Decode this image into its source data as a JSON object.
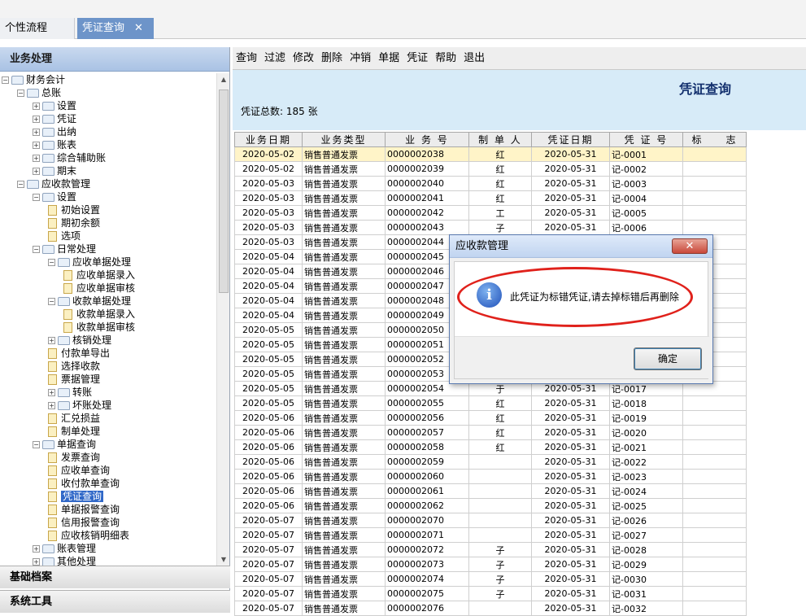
{
  "tabs": [
    {
      "label": "个性流程"
    },
    {
      "label": "凭证查询",
      "close": "✕"
    }
  ],
  "left": {
    "header": "业务处理",
    "footer": [
      "基础档案",
      "系统工具"
    ],
    "tree": [
      {
        "label": "财务会计",
        "indent": 0,
        "kind": "folder",
        "exp": "-"
      },
      {
        "label": "总账",
        "indent": 1,
        "kind": "folder",
        "exp": "-"
      },
      {
        "label": "设置",
        "indent": 2,
        "kind": "folder",
        "exp": "+"
      },
      {
        "label": "凭证",
        "indent": 2,
        "kind": "folder",
        "exp": "+"
      },
      {
        "label": "出纳",
        "indent": 2,
        "kind": "folder",
        "exp": "+"
      },
      {
        "label": "账表",
        "indent": 2,
        "kind": "folder",
        "exp": "+"
      },
      {
        "label": "综合辅助账",
        "indent": 2,
        "kind": "folder",
        "exp": "+"
      },
      {
        "label": "期末",
        "indent": 2,
        "kind": "folder",
        "exp": "+"
      },
      {
        "label": "应收款管理",
        "indent": 1,
        "kind": "folder",
        "exp": "-"
      },
      {
        "label": "设置",
        "indent": 2,
        "kind": "folder",
        "exp": "-"
      },
      {
        "label": "初始设置",
        "indent": 3,
        "kind": "doc"
      },
      {
        "label": "期初余额",
        "indent": 3,
        "kind": "doc"
      },
      {
        "label": "选项",
        "indent": 3,
        "kind": "doc"
      },
      {
        "label": "日常处理",
        "indent": 2,
        "kind": "folder",
        "exp": "-"
      },
      {
        "label": "应收单据处理",
        "indent": 3,
        "kind": "folder",
        "exp": "-"
      },
      {
        "label": "应收单据录入",
        "indent": 4,
        "kind": "doc"
      },
      {
        "label": "应收单据审核",
        "indent": 4,
        "kind": "doc"
      },
      {
        "label": "收款单据处理",
        "indent": 3,
        "kind": "folder",
        "exp": "-"
      },
      {
        "label": "收款单据录入",
        "indent": 4,
        "kind": "doc"
      },
      {
        "label": "收款单据审核",
        "indent": 4,
        "kind": "doc"
      },
      {
        "label": "核销处理",
        "indent": 3,
        "kind": "folder",
        "exp": "+"
      },
      {
        "label": "付款单导出",
        "indent": 3,
        "kind": "doc"
      },
      {
        "label": "选择收款",
        "indent": 3,
        "kind": "doc"
      },
      {
        "label": "票据管理",
        "indent": 3,
        "kind": "doc"
      },
      {
        "label": "转账",
        "indent": 3,
        "kind": "folder",
        "exp": "+"
      },
      {
        "label": "坏账处理",
        "indent": 3,
        "kind": "folder",
        "exp": "+"
      },
      {
        "label": "汇兑损益",
        "indent": 3,
        "kind": "doc"
      },
      {
        "label": "制单处理",
        "indent": 3,
        "kind": "doc"
      },
      {
        "label": "单据查询",
        "indent": 2,
        "kind": "folder",
        "exp": "-"
      },
      {
        "label": "发票查询",
        "indent": 3,
        "kind": "doc"
      },
      {
        "label": "应收单查询",
        "indent": 3,
        "kind": "doc"
      },
      {
        "label": "收付款单查询",
        "indent": 3,
        "kind": "doc"
      },
      {
        "label": "凭证查询",
        "indent": 3,
        "kind": "doc",
        "selected": true
      },
      {
        "label": "单据报警查询",
        "indent": 3,
        "kind": "doc"
      },
      {
        "label": "信用报警查询",
        "indent": 3,
        "kind": "doc"
      },
      {
        "label": "应收核销明细表",
        "indent": 3,
        "kind": "doc"
      },
      {
        "label": "账表管理",
        "indent": 2,
        "kind": "folder",
        "exp": "+"
      },
      {
        "label": "其他处理",
        "indent": 2,
        "kind": "folder",
        "exp": "+"
      }
    ]
  },
  "toolbar": [
    "查询",
    "过滤",
    "修改",
    "删除",
    "冲销",
    "单据",
    "凭证",
    "帮助",
    "退出"
  ],
  "banner": {
    "title": "凭证查询",
    "count": "凭证总数: 185 张"
  },
  "grid": {
    "columns": [
      "业务日期",
      "业务类型",
      "业 务 号",
      "制 单 人",
      "凭证日期",
      "凭 证 号",
      "标　　志"
    ],
    "rows": [
      [
        "2020-05-02",
        "销售普通发票",
        "0000002038",
        "红",
        "2020-05-31",
        "记-0001"
      ],
      [
        "2020-05-02",
        "销售普通发票",
        "0000002039",
        "红",
        "2020-05-31",
        "记-0002"
      ],
      [
        "2020-05-03",
        "销售普通发票",
        "0000002040",
        "红",
        "2020-05-31",
        "记-0003"
      ],
      [
        "2020-05-03",
        "销售普通发票",
        "0000002041",
        "红",
        "2020-05-31",
        "记-0004"
      ],
      [
        "2020-05-03",
        "销售普通发票",
        "0000002042",
        "工",
        "2020-05-31",
        "记-0005"
      ],
      [
        "2020-05-03",
        "销售普通发票",
        "0000002043",
        "子",
        "2020-05-31",
        "记-0006"
      ],
      [
        "2020-05-03",
        "销售普通发票",
        "0000002044",
        "",
        "",
        ""
      ],
      [
        "2020-05-04",
        "销售普通发票",
        "0000002045",
        "",
        "",
        ""
      ],
      [
        "2020-05-04",
        "销售普通发票",
        "0000002046",
        "",
        "",
        ""
      ],
      [
        "2020-05-04",
        "销售普通发票",
        "0000002047",
        "",
        "",
        ""
      ],
      [
        "2020-05-04",
        "销售普通发票",
        "0000002048",
        "",
        "",
        ""
      ],
      [
        "2020-05-04",
        "销售普通发票",
        "0000002049",
        "",
        "",
        ""
      ],
      [
        "2020-05-05",
        "销售普通发票",
        "0000002050",
        "",
        "",
        ""
      ],
      [
        "2020-05-05",
        "销售普通发票",
        "0000002051",
        "",
        "",
        ""
      ],
      [
        "2020-05-05",
        "销售普通发票",
        "0000002052",
        "",
        "",
        ""
      ],
      [
        "2020-05-05",
        "销售普通发票",
        "0000002053",
        "",
        "",
        ""
      ],
      [
        "2020-05-05",
        "销售普通发票",
        "0000002054",
        "于",
        "2020-05-31",
        "记-0017"
      ],
      [
        "2020-05-05",
        "销售普通发票",
        "0000002055",
        "红",
        "2020-05-31",
        "记-0018"
      ],
      [
        "2020-05-06",
        "销售普通发票",
        "0000002056",
        "红",
        "2020-05-31",
        "记-0019"
      ],
      [
        "2020-05-06",
        "销售普通发票",
        "0000002057",
        "红",
        "2020-05-31",
        "记-0020"
      ],
      [
        "2020-05-06",
        "销售普通发票",
        "0000002058",
        "红",
        "2020-05-31",
        "记-0021"
      ],
      [
        "2020-05-06",
        "销售普通发票",
        "0000002059",
        "",
        "2020-05-31",
        "记-0022"
      ],
      [
        "2020-05-06",
        "销售普通发票",
        "0000002060",
        "",
        "2020-05-31",
        "记-0023"
      ],
      [
        "2020-05-06",
        "销售普通发票",
        "0000002061",
        "",
        "2020-05-31",
        "记-0024"
      ],
      [
        "2020-05-06",
        "销售普通发票",
        "0000002062",
        "",
        "2020-05-31",
        "记-0025"
      ],
      [
        "2020-05-07",
        "销售普通发票",
        "0000002070",
        "",
        "2020-05-31",
        "记-0026"
      ],
      [
        "2020-05-07",
        "销售普通发票",
        "0000002071",
        "",
        "2020-05-31",
        "记-0027"
      ],
      [
        "2020-05-07",
        "销售普通发票",
        "0000002072",
        "子",
        "2020-05-31",
        "记-0028"
      ],
      [
        "2020-05-07",
        "销售普通发票",
        "0000002073",
        "子",
        "2020-05-31",
        "记-0029"
      ],
      [
        "2020-05-07",
        "销售普通发票",
        "0000002074",
        "子",
        "2020-05-31",
        "记-0030"
      ],
      [
        "2020-05-07",
        "销售普通发票",
        "0000002075",
        "子",
        "2020-05-31",
        "记-0031"
      ],
      [
        "2020-05-07",
        "销售普通发票",
        "0000002076",
        "",
        "2020-05-31",
        "记-0032"
      ]
    ]
  },
  "dialog": {
    "title": "应收款管理",
    "close": "✕",
    "icon": "i",
    "message": "此凭证为标错凭证,请去掉标错后再删除",
    "ok": "确定"
  }
}
